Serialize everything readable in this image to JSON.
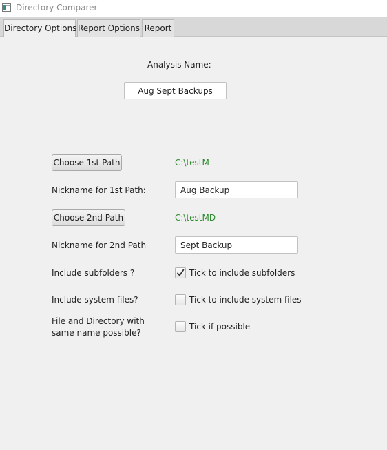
{
  "window": {
    "title": "Directory Comparer",
    "app_icon": "app-window-icon"
  },
  "tabs": [
    {
      "label": "Directory Options",
      "active": true
    },
    {
      "label": "Report Options",
      "active": false
    },
    {
      "label": "Report",
      "active": false
    }
  ],
  "analysis": {
    "label": "Analysis Name:",
    "value": "Aug Sept Backups"
  },
  "path1": {
    "button_label": "Choose 1st Path",
    "value": "C:\\testM",
    "nickname_label": "Nickname for 1st Path:",
    "nickname_value": "Aug Backup"
  },
  "path2": {
    "button_label": "Choose 2nd Path",
    "value": "C:\\testMD",
    "nickname_label": "Nickname for 2nd Path",
    "nickname_value": "Sept Backup"
  },
  "options": {
    "subfolders": {
      "label": "Include subfolders ?",
      "checkbox_label": "Tick to include subfolders",
      "checked": true
    },
    "system_files": {
      "label": "Include system files?",
      "checkbox_label": "Tick to include system files",
      "checked": false
    },
    "same_name": {
      "label": "File and Directory with same name possible?",
      "checkbox_label": "Tick if possible",
      "checked": false
    }
  },
  "colors": {
    "path_value": "#2a8a2a",
    "background": "#f0f0f0"
  }
}
